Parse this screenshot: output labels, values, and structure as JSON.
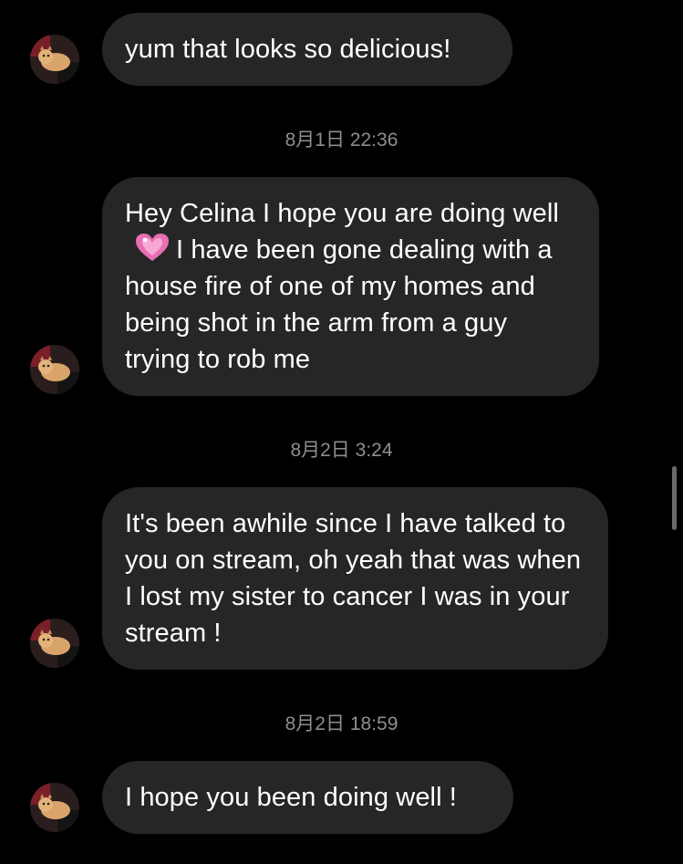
{
  "messages": [
    {
      "text": "yum that looks so delicious!"
    },
    {
      "text_part1": "Hey Celina I hope you are doing well",
      "emoji": "heart-emoji",
      "text_part2": "I have been gone dealing with a house fire of one of my homes and being shot in the arm from a guy trying to rob me"
    },
    {
      "text": "It's been awhile since I have talked to you on stream, oh yeah that was when I lost my sister to cancer I was in your stream !"
    },
    {
      "text": "I hope you been doing well !"
    }
  ],
  "timestamps": [
    "8月1日 22:36",
    "8月2日 3:24",
    "8月2日 18:59"
  ],
  "colors": {
    "background": "#000000",
    "bubble": "#262626",
    "text": "#ffffff",
    "timestamp": "#8e8e8e",
    "heart": "#e86fb3"
  },
  "avatar_icon": "avatar-cat-photo"
}
